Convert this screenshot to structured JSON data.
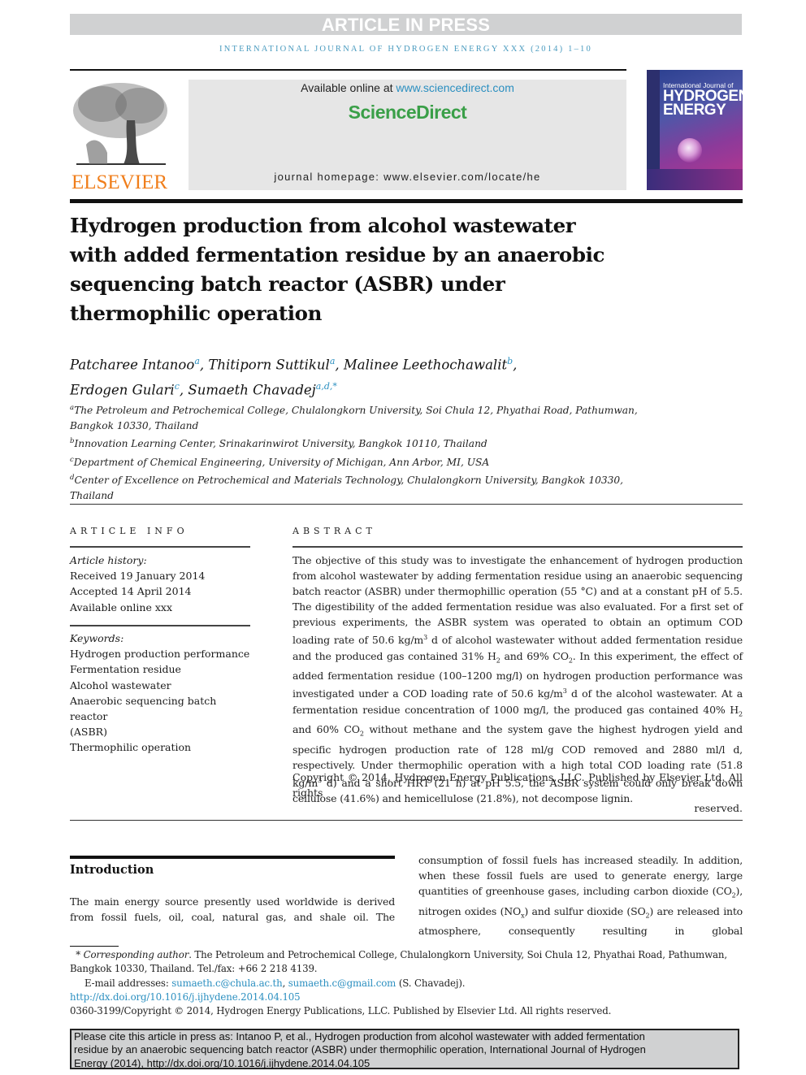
{
  "banner": {
    "article_in_press": "ARTICLE IN PRESS"
  },
  "running_head": "INTERNATIONAL JOURNAL OF HYDROGEN ENERGY XXX (2014) 1–10",
  "masthead": {
    "publisher_logo_text": "ELSEVIER",
    "available_online_prefix": "Available online at ",
    "available_online_link": "www.sciencedirect.com",
    "sciencedirect": "ScienceDirect",
    "homepage": "journal homepage: www.elsevier.com/locate/he",
    "cover": {
      "line1": "International Journal of",
      "line2": "HYDROGEN",
      "line3": "ENERGY"
    },
    "colors": {
      "elsevier_orange": "#f07e1b",
      "sciencedirect_green": "#3a9f48",
      "link_blue": "#2b8fc0"
    }
  },
  "article": {
    "title_lines": [
      "Hydrogen production from alcohol wastewater",
      "with added fermentation residue by an anaerobic",
      "sequencing batch reactor (ASBR) under",
      "thermophilic operation"
    ],
    "authors": [
      {
        "name": "Patcharee Intanoo",
        "sup": "a",
        "sep": ", "
      },
      {
        "name": "Thitiporn Suttikul",
        "sup": "a",
        "sep": ", "
      },
      {
        "name": "Malinee Leethochawalit",
        "sup": "b",
        "sep": ","
      },
      {
        "name": "Erdogen Gulari",
        "sup": "c",
        "sep": ", "
      },
      {
        "name": "Sumaeth Chavadej",
        "sup": "a,d,*",
        "sep": ""
      }
    ],
    "affiliations": [
      {
        "mark": "a",
        "lines": [
          "The Petroleum and Petrochemical College, Chulalongkorn University, Soi Chula 12, Phyathai Road, Pathumwan,",
          "Bangkok 10330, Thailand"
        ]
      },
      {
        "mark": "b",
        "lines": [
          "Innovation Learning Center, Srinakarinwirot University, Bangkok 10110, Thailand"
        ]
      },
      {
        "mark": "c",
        "lines": [
          "Department of Chemical Engineering, University of Michigan, Ann Arbor, MI, USA"
        ]
      },
      {
        "mark": "d",
        "lines": [
          "Center of Excellence on Petrochemical and Materials Technology, Chulalongkorn University, Bangkok 10330,",
          "Thailand"
        ]
      }
    ]
  },
  "article_info": {
    "heading": "ARTICLE INFO",
    "history_label": "Article history:",
    "history": [
      "Received 19 January 2014",
      "Accepted 14 April 2014",
      "Available online xxx"
    ],
    "keywords_label": "Keywords:",
    "keywords": [
      "Hydrogen production performance",
      "Fermentation residue",
      "Alcohol wastewater",
      "Anaerobic sequencing batch reactor",
      "(ASBR)",
      "Thermophilic operation"
    ]
  },
  "abstract": {
    "heading": "ABSTRACT",
    "p1": "The objective of this study was to investigate the enhancement of hydrogen production from alcohol wastewater by adding fermentation residue using an anaerobic sequencing batch reactor (ASBR) under thermophillic operation (55 °C) and at a constant pH of 5.5. The digestibility of the added fermentation residue was also evaluated. For a first set of previous experiments, the ASBR system was operated to obtain an optimum COD loading rate of 50.6 kg/m",
    "p2": " d of alcohol wastewater without added fermentation residue and the produced gas contained 31% H",
    "p3": " and 69% CO",
    "p4": ". In this experiment, the effect of added fermentation residue (100–1200 mg/l) on hydrogen production performance was investigated under a COD loading rate of 50.6 kg/m",
    "p5": " d of the alcohol wastewater. At a fermentation residue concentration of 1000 mg/l, the produced gas contained 40% H",
    "p6": " and 60% CO",
    "p7": " without methane and the system gave the highest hydrogen yield and specific hydrogen production rate of 128 ml/g COD removed and 2880 ml/l d, respectively. Under thermophilic operation with a high total COD loading rate (51.8 kg/m",
    "p8": " d) and a short HRT (21 h) at pH 5.5, the ASBR system could only break down cellulose (41.6%) and hemicellulose (21.8%), not decompose lignin.",
    "sup3": "3",
    "sub2": "2",
    "copyright_line1": "Copyright © 2014, Hydrogen Energy Publications, LLC. Published by Elsevier Ltd. All rights",
    "copyright_line2": "reserved."
  },
  "introduction": {
    "heading": "Introduction",
    "left": "The main energy source presently used worldwide is derived from fossil fuels, oil, coal, natural gas, and shale oil. The",
    "right_a": "consumption of fossil fuels has increased steadily. In addition, when these fossil fuels are used to generate energy, large quantities of greenhouse gases, including carbon dioxide (CO",
    "right_b": "), nitrogen oxides (NO",
    "right_c": ") and sulfur dioxide (SO",
    "right_d": ") are released into atmosphere, consequently resulting in global",
    "sub_x": "x",
    "sub_2": "2"
  },
  "footnotes": {
    "corr_mark": "*",
    "corr_label": "Corresponding author",
    "corr_text": ". The Petroleum and Petrochemical College, Chulalongkorn University, Soi Chula 12, Phyathai Road, Pathumwan, Bangkok 10330, Thailand. Tel./fax: +66 2 218 4139.",
    "email_label": "E-mail addresses: ",
    "email1": "sumaeth.c@chula.ac.th",
    "email_sep": ", ",
    "email2": "sumaeth.c@gmail.com",
    "email_owner": " (S. Chavadej).",
    "doi": "http://dx.doi.org/10.1016/j.ijhydene.2014.04.105",
    "issn_copyright": "0360-3199/Copyright © 2014, Hydrogen Energy Publications, LLC. Published by Elsevier Ltd. All rights reserved."
  },
  "citation_box": {
    "line1": "Please cite this article in press as: Intanoo P, et al., Hydrogen production from alcohol wastewater with added fermentation",
    "line2": "residue by an anaerobic sequencing batch reactor (ASBR) under thermophilic operation, International Journal of Hydrogen",
    "line3": "Energy (2014), http://dx.doi.org/10.1016/j.ijhydene.2014.04.105"
  }
}
